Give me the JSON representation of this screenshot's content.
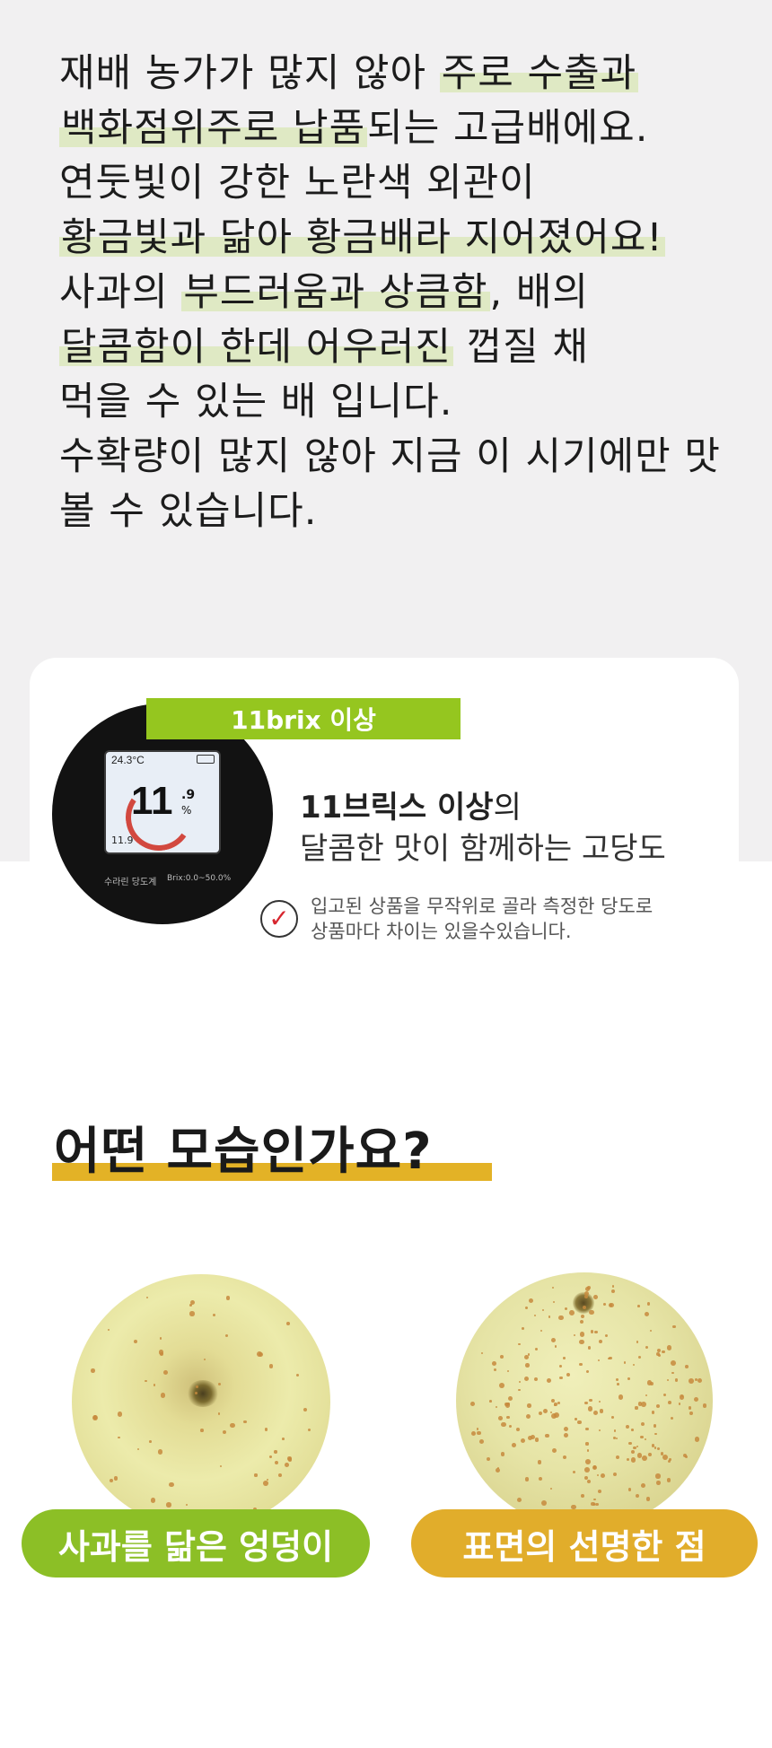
{
  "intro": {
    "lines": [
      [
        {
          "t": "재배 농가가 많지 않아 "
        },
        {
          "t": "주로 수출과",
          "h": true
        }
      ],
      [
        {
          "t": "백화점위주로 납품",
          "h": true
        },
        {
          "t": "되는 고급배에요."
        }
      ],
      [
        {
          "t": "연둣빛이 강한 노란색 외관이"
        }
      ],
      [
        {
          "t": "황금빛과 닮아 황금배라 지어졌어요!",
          "h": true
        }
      ],
      [
        {
          "t": "사과의 "
        },
        {
          "t": "부드러움과 상큼함",
          "h": true
        },
        {
          "t": ", 배의"
        }
      ],
      [
        {
          "t": "달콤함이 한데 어우러진",
          "h": true
        },
        {
          "t": " 껍질 채"
        }
      ],
      [
        {
          "t": "먹을 수 있는 배 입니다."
        }
      ],
      [
        {
          "t": "수확량이 많지 않아 지금 이 시기에만 맛"
        }
      ],
      [
        {
          "t": "볼 수 있습니다."
        }
      ]
    ]
  },
  "brix": {
    "tag": "11brix 이상",
    "title_bold": "11브릭스 이상",
    "title_rest": "의",
    "subtitle": "달콤한 맛이 함께하는 고당도",
    "note_line1": "입고된 상품을 무작위로 골라 측정한 당도로",
    "note_line2": "상품마다 차이는 있을수있습니다.",
    "check_icon": "✓",
    "meter": {
      "temp": "24.3°C",
      "value": "11",
      "decimal": ".9",
      "unit": "%",
      "small_value": "11.9",
      "label_name": "수라린 당도계",
      "label_range": "Brix:0.0~50.0%"
    }
  },
  "shape": {
    "title": "어떤 모습인가요?",
    "feature1": "사과를 닮은 엉덩이",
    "feature2": "표면의 선명한 점"
  },
  "colors": {
    "highlight": "#dfe9c4",
    "green": "#8cbf26",
    "gold": "#e1ad2b",
    "check": "#d7262f"
  }
}
